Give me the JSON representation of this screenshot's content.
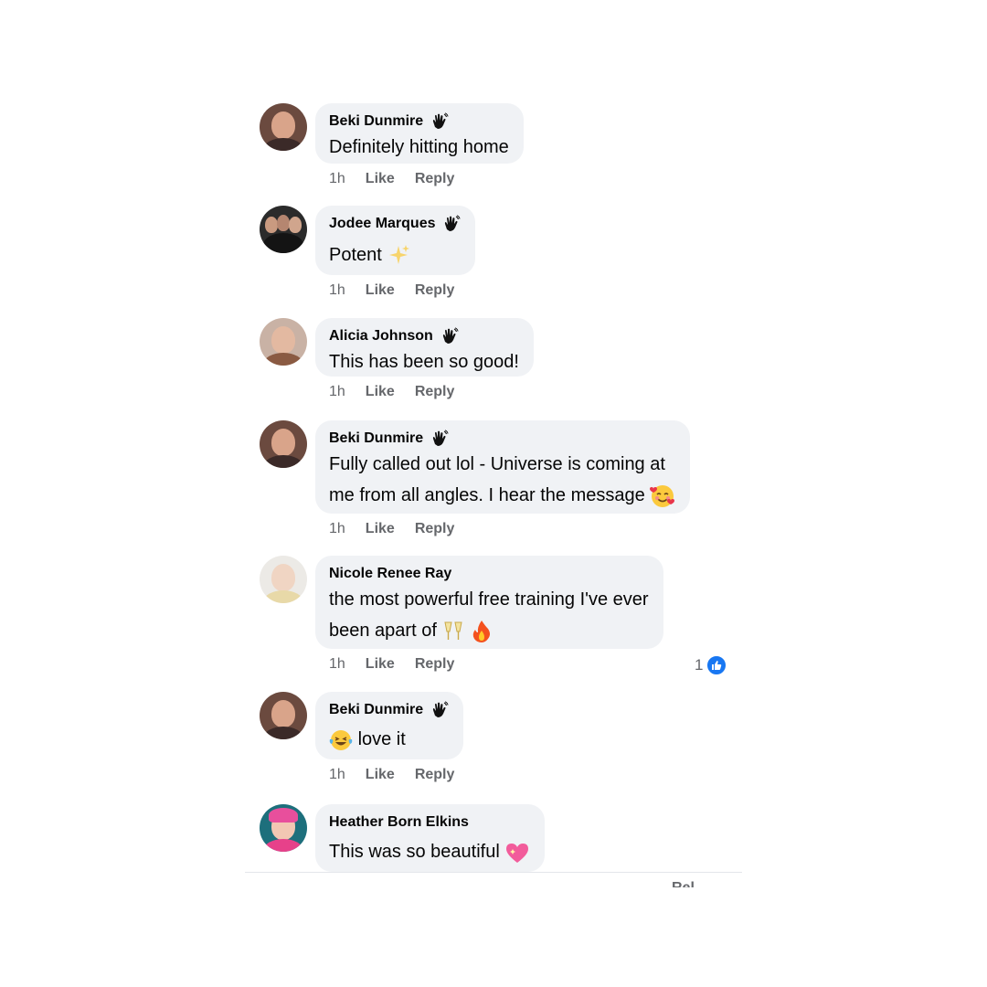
{
  "comments": [
    {
      "author": "Beki Dunmire",
      "lines": [
        "Definitely hitting home"
      ],
      "time": "1h",
      "like": "Like",
      "reply": "Reply"
    },
    {
      "author": "Jodee Marques",
      "lines": [
        "Potent"
      ],
      "time": "1h",
      "like": "Like",
      "reply": "Reply"
    },
    {
      "author": "Alicia Johnson",
      "lines": [
        "This has been so good!"
      ],
      "time": "1h",
      "like": "Like",
      "reply": "Reply"
    },
    {
      "author": "Beki Dunmire",
      "lines": [
        "Fully called out lol - Universe is coming at",
        "me from all angles. I hear the message"
      ],
      "time": "1h",
      "like": "Like",
      "reply": "Reply"
    },
    {
      "author": "Nicole Renee Ray",
      "lines": [
        "the most powerful free training I've ever",
        "been apart of"
      ],
      "time": "1h",
      "like": "Like",
      "reply": "Reply",
      "reaction_count": "1"
    },
    {
      "author": "Beki Dunmire",
      "lines": [
        "love it"
      ],
      "time": "1h",
      "like": "Like",
      "reply": "Reply"
    },
    {
      "author": "Heather Born Elkins",
      "lines": [
        "This was so beautiful"
      ]
    }
  ],
  "footer_cutoff_text": "Rel",
  "icons": {
    "badge": "wave-hand-icon",
    "reaction": "thumbs-up-icon"
  },
  "colors": {
    "bubble": "#f0f2f5",
    "meta": "#65676b",
    "like_blue": "#1877f2"
  }
}
